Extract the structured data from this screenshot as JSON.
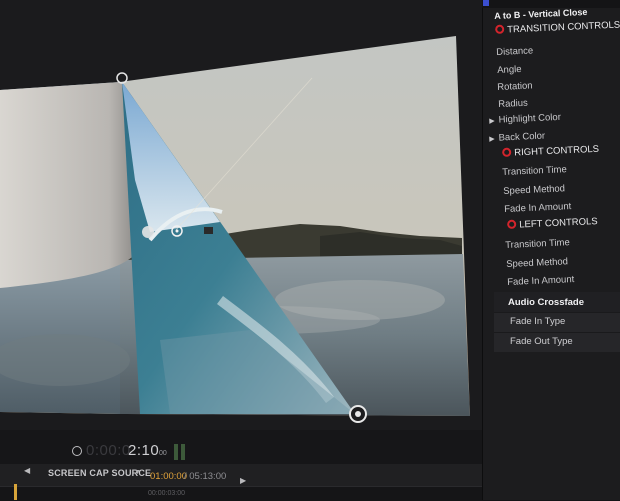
{
  "viewer": {
    "zoom_readout": "⊞ ▣ ⊡"
  },
  "transport": {
    "timecode_prefix": "0:00:0",
    "timecode_main": "2:10",
    "timecode_frames": "00"
  },
  "timeline": {
    "back_glyph": "◀",
    "source_label": "SCREEN CAP SOURCE",
    "chevron_glyph": "▼",
    "current_time": "01:00:00",
    "total_time": "/ 05:13:00",
    "forward_glyph": "▶",
    "ruler_label": "00:00:03:00"
  },
  "inspector": {
    "title": "A to B - Vertical Close",
    "transition_controls": "TRANSITION CONTROLS",
    "distance": "Distance",
    "angle": "Angle",
    "rotation": "Rotation",
    "radius": "Radius",
    "highlight_color": "Highlight Color",
    "back_color": "Back Color",
    "expand_glyph": "▶",
    "right_controls": "RIGHT CONTROLS",
    "right_transition_time": "Transition Time",
    "right_speed_method": "Speed Method",
    "right_fade_in_amount": "Fade In Amount",
    "left_controls": "LEFT CONTROLS",
    "left_transition_time": "Transition Time",
    "left_speed_method": "Speed Method",
    "left_fade_in_amount": "Fade In Amount"
  },
  "audio": {
    "heading": "Audio Crossfade",
    "fade_in_type": "Fade In Type",
    "fade_out_type": "Fade Out Type"
  },
  "colors": {
    "accent_ring": "#d3242c",
    "timecode_orange": "#e0a23a",
    "playhead": "#d7a43a"
  }
}
